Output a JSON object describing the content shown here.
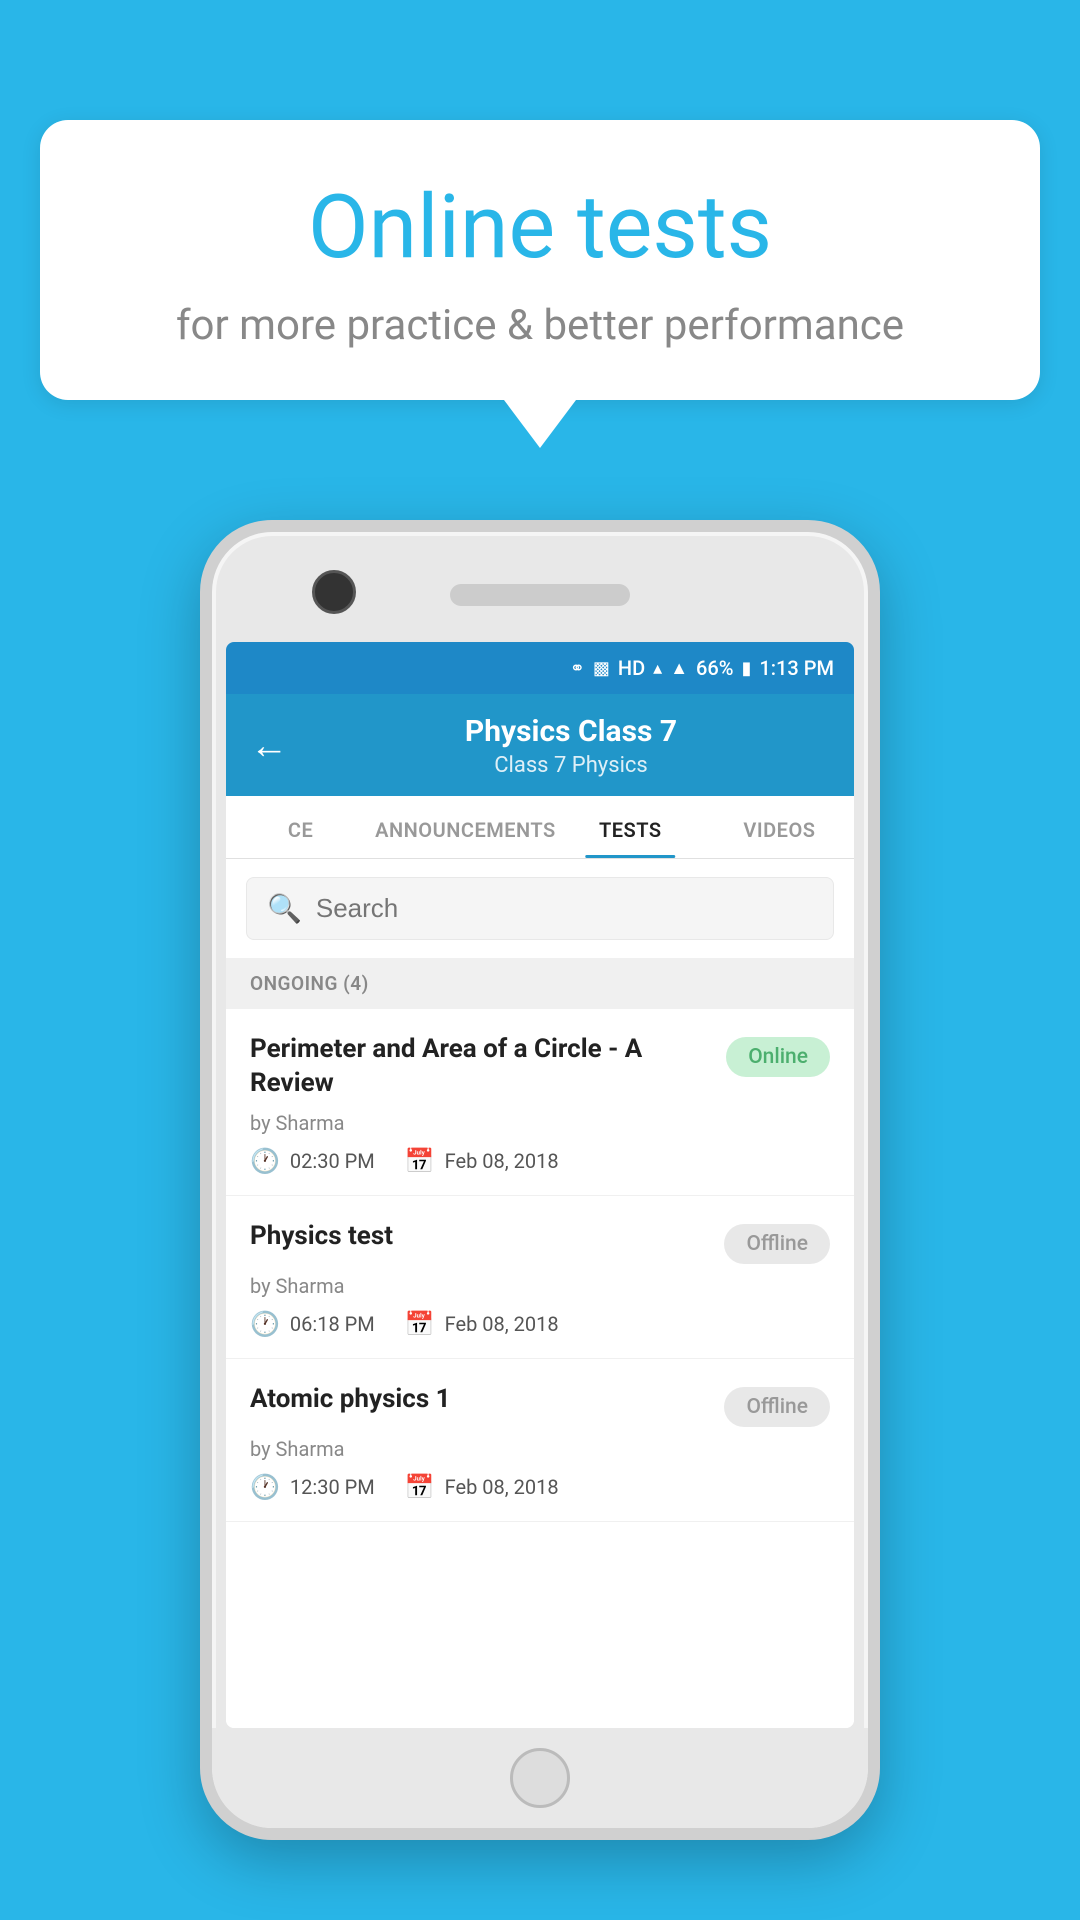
{
  "background_color": "#29b6e8",
  "bubble": {
    "title": "Online tests",
    "subtitle": "for more practice & better performance"
  },
  "status_bar": {
    "time": "1:13 PM",
    "battery": "66%",
    "icons": [
      "bluetooth",
      "vibrate",
      "hd",
      "wifi",
      "signal",
      "x-signal"
    ]
  },
  "header": {
    "back_label": "←",
    "title": "Physics Class 7",
    "subtitle": "Class 7   Physics"
  },
  "tabs": [
    {
      "label": "CE",
      "active": false
    },
    {
      "label": "ANNOUNCEMENTS",
      "active": false
    },
    {
      "label": "TESTS",
      "active": true
    },
    {
      "label": "VIDEOS",
      "active": false
    }
  ],
  "search": {
    "placeholder": "Search"
  },
  "section": {
    "label": "ONGOING (4)"
  },
  "tests": [
    {
      "title": "Perimeter and Area of a Circle - A Review",
      "author": "by Sharma",
      "time": "02:30 PM",
      "date": "Feb 08, 2018",
      "status": "Online",
      "status_type": "online"
    },
    {
      "title": "Physics test",
      "author": "by Sharma",
      "time": "06:18 PM",
      "date": "Feb 08, 2018",
      "status": "Offline",
      "status_type": "offline"
    },
    {
      "title": "Atomic physics 1",
      "author": "by Sharma",
      "time": "12:30 PM",
      "date": "Feb 08, 2018",
      "status": "Offline",
      "status_type": "offline"
    }
  ]
}
